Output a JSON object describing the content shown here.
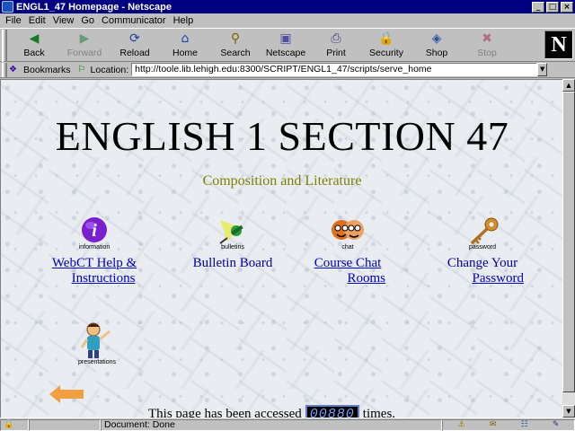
{
  "window": {
    "title": "ENGL1_47 Homepage - Netscape",
    "buttons": {
      "minimize": "_",
      "maximize": "□",
      "close": "×"
    }
  },
  "menubar": {
    "items": [
      "File",
      "Edit",
      "View",
      "Go",
      "Communicator",
      "Help"
    ]
  },
  "toolbar": {
    "items": [
      {
        "label": "Back",
        "icon": "back-arrow-icon",
        "glyph": "◀",
        "color": "#1a7a2a",
        "disabled": false
      },
      {
        "label": "Forward",
        "icon": "forward-arrow-icon",
        "glyph": "▶",
        "color": "#1a7a2a",
        "disabled": true
      },
      {
        "label": "Reload",
        "icon": "reload-icon",
        "glyph": "⟳",
        "color": "#2040a0",
        "disabled": false
      },
      {
        "label": "Home",
        "icon": "home-icon",
        "glyph": "⌂",
        "color": "#2040a0",
        "disabled": false
      },
      {
        "label": "Search",
        "icon": "search-icon",
        "glyph": "⚲",
        "color": "#806000",
        "disabled": false
      },
      {
        "label": "Netscape",
        "icon": "netscape-icon",
        "glyph": "▣",
        "color": "#5050a0",
        "disabled": false
      },
      {
        "label": "Print",
        "icon": "print-icon",
        "glyph": "⎙",
        "color": "#404080",
        "disabled": false
      },
      {
        "label": "Security",
        "icon": "lock-icon",
        "glyph": "🔒",
        "color": "#a03030",
        "disabled": false
      },
      {
        "label": "Shop",
        "icon": "shop-icon",
        "glyph": "◈",
        "color": "#3050a0",
        "disabled": false
      },
      {
        "label": "Stop",
        "icon": "stop-icon",
        "glyph": "✖",
        "color": "#a02040",
        "disabled": true
      }
    ],
    "logo": "N"
  },
  "locationbar": {
    "bookmarks_label": "Bookmarks",
    "location_label": "Location:",
    "url": "http://toole.lib.lehigh.edu:8300/SCRIPT/ENGL1_47/scripts/serve_home"
  },
  "content": {
    "title": "ENGLISH 1 SECTION 47",
    "subtitle": "Composition and Literature",
    "links": [
      {
        "icon": "information-icon",
        "caption": "information",
        "line1": "WebCT Help &",
        "line2": "Instructions",
        "underlined": true
      },
      {
        "icon": "bulletin-pushpin-icon",
        "caption": "bulletins",
        "line1": "Bulletin Board",
        "line2": "",
        "underlined": false
      },
      {
        "icon": "chat-faces-icon",
        "caption": "chat",
        "line1": "Course Chat",
        "line2": "Rooms",
        "underlined": true
      },
      {
        "icon": "password-key-icon",
        "caption": "password",
        "line1": "Change Your",
        "line2": "Password",
        "underlined": true
      }
    ],
    "presentations_caption": "presentations",
    "counter_prefix": "This page has been accessed",
    "counter_value": "00880",
    "counter_suffix": "times."
  },
  "statusbar": {
    "text": "Document: Done"
  }
}
